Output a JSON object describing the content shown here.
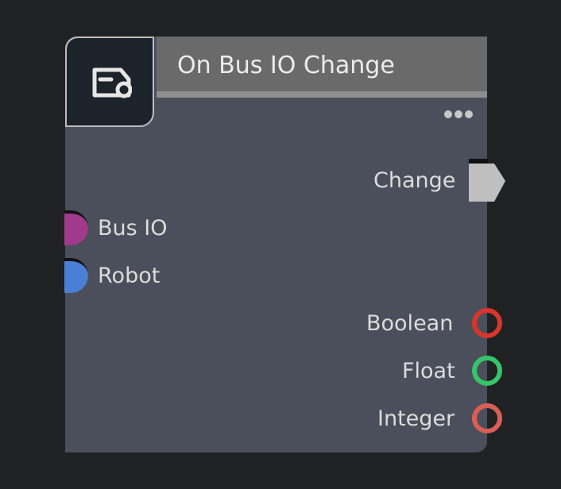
{
  "node": {
    "title": "On Bus IO Change",
    "icon": "event-message-icon",
    "more_icon": "more-dots-icon"
  },
  "outputs_exec": [
    {
      "label": "Change",
      "icon": "exec-arrow-icon",
      "color": "#bfbfbf"
    }
  ],
  "inputs": [
    {
      "label": "Bus IO",
      "color": "#a23a8c"
    },
    {
      "label": "Robot",
      "color": "#4a7fd6"
    }
  ],
  "outputs": [
    {
      "label": "Boolean",
      "color": "#d8352c"
    },
    {
      "label": "Float",
      "color": "#35c46a"
    },
    {
      "label": "Integer",
      "color": "#d95f56"
    }
  ],
  "colors": {
    "background": "#202123",
    "node_body": "#4b4f5b",
    "node_header": "#6a6a6a",
    "icon_box": "#1c232b"
  }
}
